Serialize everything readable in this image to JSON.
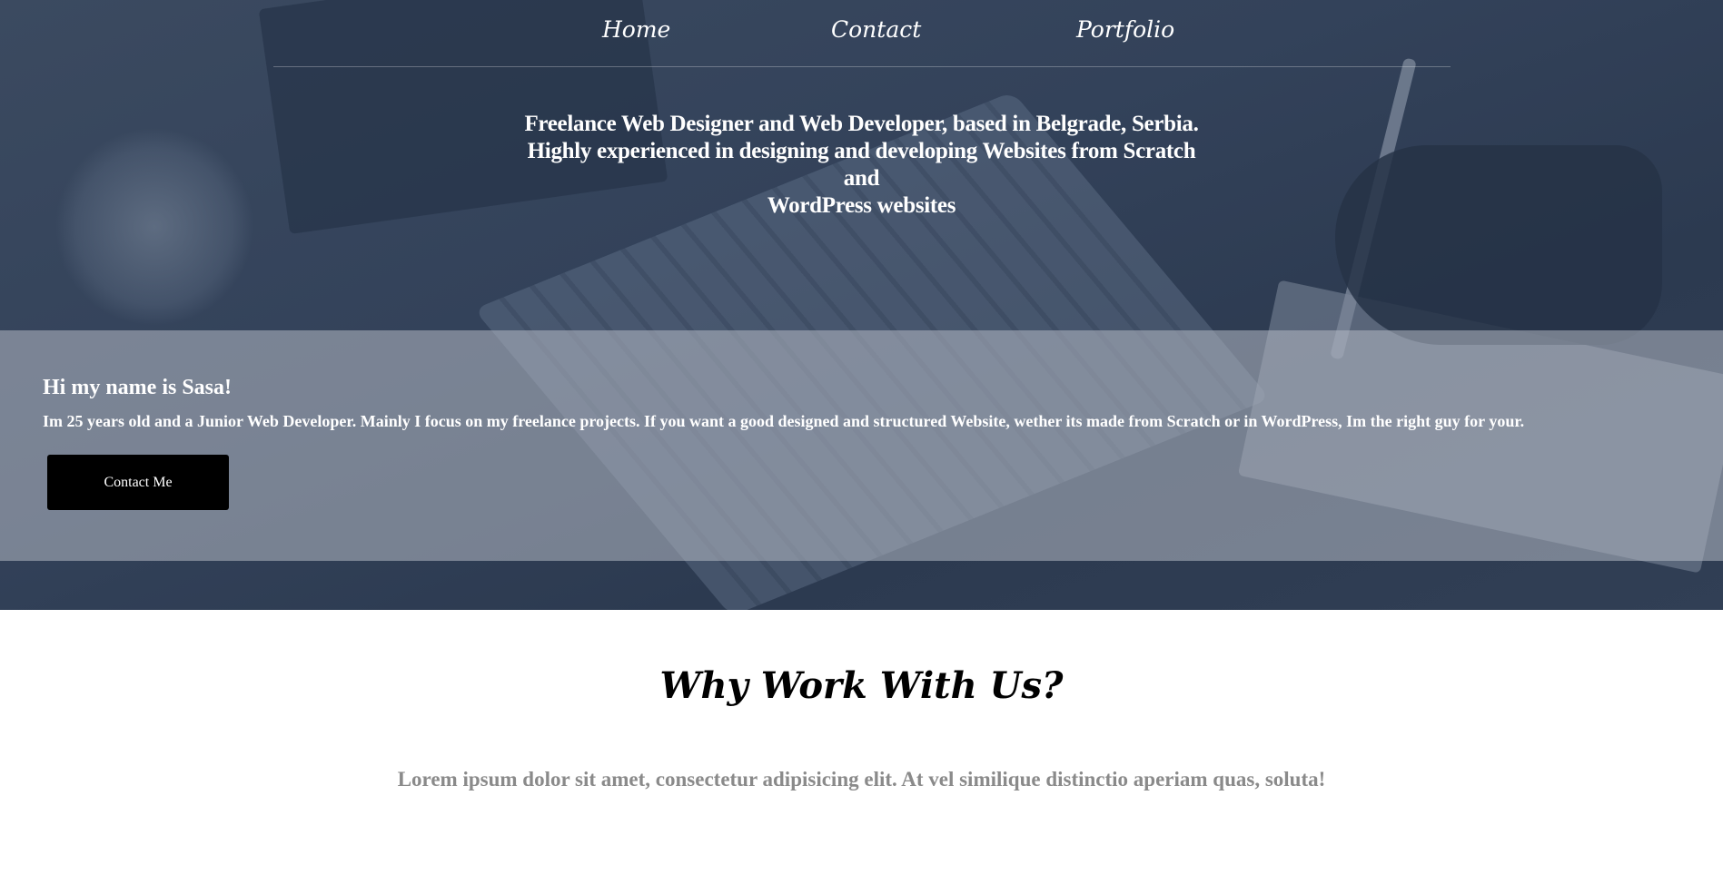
{
  "nav": {
    "items": [
      {
        "label": "Home"
      },
      {
        "label": "Contact"
      },
      {
        "label": "Portfolio"
      }
    ]
  },
  "hero": {
    "tagline_line1": "Freelance Web Designer and Web Developer, based in Belgrade, Serbia.",
    "tagline_line2": "Highly experienced in designing and developing Websites from Scratch and",
    "tagline_line3": "WordPress websites"
  },
  "about": {
    "title": "Hi my name is Sasa!",
    "text": "Im 25 years old and a Junior Web Developer. Mainly I focus on my freelance projects. If you want a good designed and structured Website, wether its made from Scratch or in WordPress, Im the right guy for your.",
    "button_label": "Contact Me"
  },
  "why": {
    "title": "Why Work With Us?",
    "text": "Lorem ipsum dolor sit amet, consectetur adipisicing elit. At vel similique distinctio aperiam quas, soluta!"
  },
  "colors": {
    "hero_overlay": "#33425a",
    "band": "#b4bac4",
    "button_bg": "#000000",
    "muted_text": "#8a8a8a"
  }
}
